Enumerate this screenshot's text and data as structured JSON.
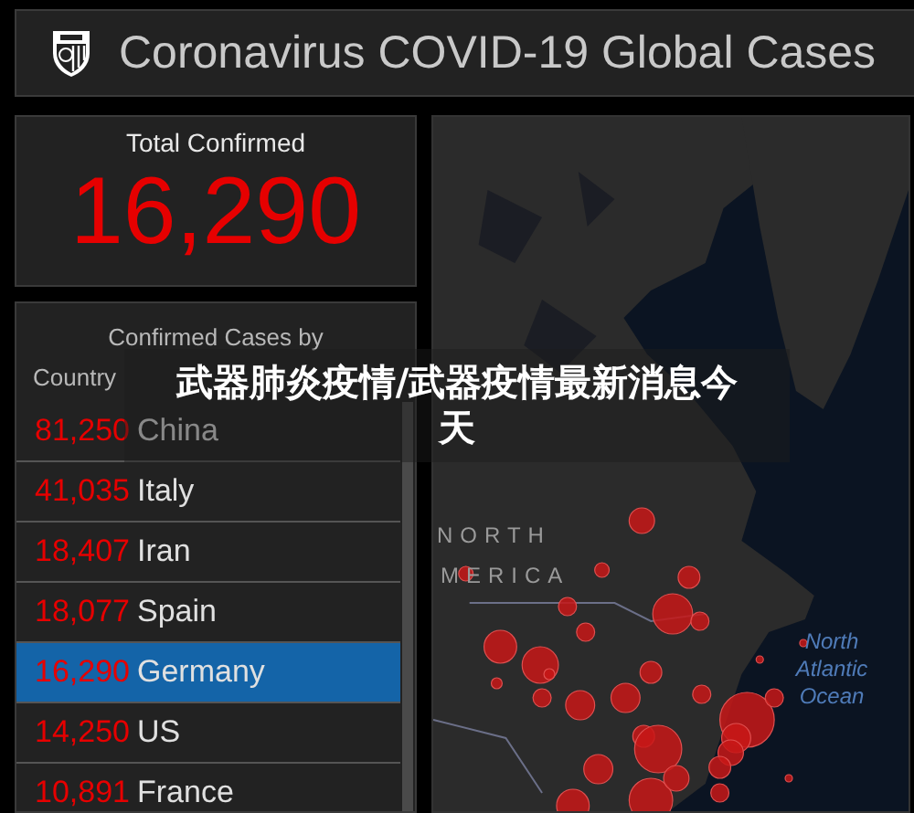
{
  "header": {
    "title": "Coronavirus COVID-19 Global Cases"
  },
  "total": {
    "label": "Total Confirmed",
    "value": "16,290"
  },
  "country_list": {
    "title_line_1": "Confirmed Cases by",
    "title_line_2": "Country",
    "rows": [
      {
        "count": "81,250",
        "country": "China",
        "selected": false
      },
      {
        "count": "41,035",
        "country": "Italy",
        "selected": false
      },
      {
        "count": "18,407",
        "country": "Iran",
        "selected": false
      },
      {
        "count": "18,077",
        "country": "Spain",
        "selected": false
      },
      {
        "count": "16,290",
        "country": "Germany",
        "selected": true
      },
      {
        "count": "14,250",
        "country": "US",
        "selected": false
      },
      {
        "count": "10,891",
        "country": "France",
        "selected": false
      }
    ]
  },
  "map": {
    "region_label_1": "NORTH",
    "region_label_2": "MERICA",
    "ocean_label": "North Atlantic Ocean"
  },
  "caption": "武器肺炎疫情/武器疫情最新消息今天"
}
